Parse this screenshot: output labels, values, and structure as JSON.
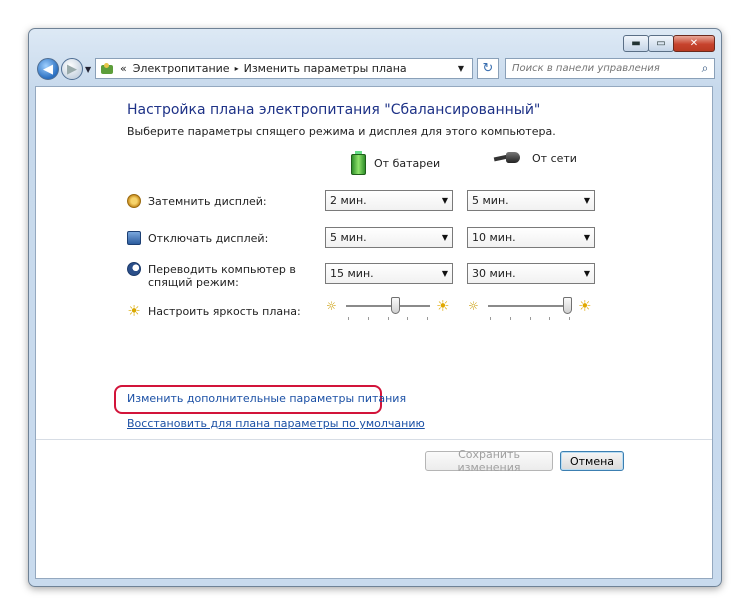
{
  "window": {
    "buttons": {
      "minimize": "▬",
      "maximize": "▭",
      "close": "✕"
    }
  },
  "navigation": {
    "back_icon": "◀",
    "forward_icon": "▶",
    "breadcrumb": {
      "overflow": "«",
      "items": [
        "Электропитание",
        "Изменить параметры плана"
      ],
      "separator": "▸"
    },
    "dropdown_arrow": "▼",
    "refresh_icon": "↻",
    "search_placeholder": "Поиск в панели управления",
    "search_icon": "⌕"
  },
  "plan": {
    "title": "Настройка плана электропитания \"Сбалансированный\"",
    "subtitle": "Выберите параметры спящего режима и дисплея для этого компьютера.",
    "columns": {
      "battery": "От батареи",
      "plugged": "От сети"
    },
    "rows": [
      {
        "label": "Затемнить дисплей:",
        "battery": "2 мин.",
        "plugged": "5 мин.",
        "icon": "dim-icon"
      },
      {
        "label": "Отключать дисплей:",
        "battery": "5 мин.",
        "plugged": "10 мин.",
        "icon": "monitor-icon"
      },
      {
        "label": "Переводить компьютер в спящий режим:",
        "battery": "15 мин.",
        "plugged": "30 мин.",
        "icon": "sleep-icon"
      }
    ],
    "brightness": {
      "label": "Настроить яркость плана:",
      "battery_level": 0.6,
      "plugged_level": 1.0
    },
    "select_arrow": "▼"
  },
  "links": {
    "advanced": "Изменить дополнительные параметры питания",
    "restore": "Восстановить для плана параметры по умолчанию"
  },
  "buttons": {
    "save": "Сохранить изменения",
    "cancel": "Отмена"
  },
  "colors": {
    "title": "#1e3287",
    "link": "#1b50a5",
    "highlight": "#d2143a"
  }
}
